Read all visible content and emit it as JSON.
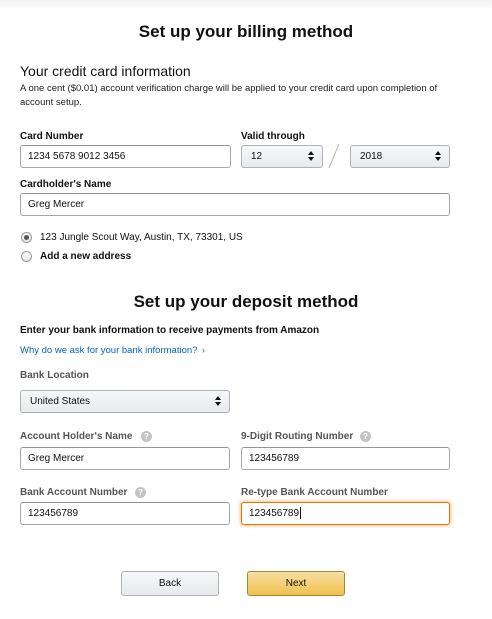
{
  "billing": {
    "title": "Set up your billing method",
    "card_heading": "Your credit card information",
    "description": "A one cent ($0.01) account verification charge will be applied to your credit card upon completion of account setup.",
    "card_number_label": "Card Number",
    "card_number_value": "1234 5678 9012 3456",
    "valid_through_label": "Valid through",
    "month_value": "12",
    "year_value": "2018",
    "cardholder_label": "Cardholder's Name",
    "cardholder_value": "Greg Mercer",
    "address_option": "123 Jungle Scout Way, Austin, TX, 73301, US",
    "new_address_option": "Add a new address"
  },
  "deposit": {
    "title": "Set up your deposit method",
    "intro": "Enter your bank information to receive payments from Amazon",
    "why_link": "Why do we ask for your bank information?",
    "bank_location_label": "Bank Location",
    "bank_location_value": "United States",
    "holder_label": "Account Holder's Name",
    "holder_value": "Greg Mercer",
    "routing_label": "9-Digit Routing Number",
    "routing_value": "123456789",
    "account_label": "Bank Account Number",
    "account_value": "123456789",
    "retype_label": "Re-type Bank Account Number",
    "retype_value": "123456789"
  },
  "actions": {
    "back_label": "Back",
    "next_label": "Next"
  },
  "icons": {
    "help": "?",
    "link_arrow": "›"
  },
  "colors": {
    "link": "#0066c0",
    "focus_border": "#e77600",
    "next_button": "#f0c14b"
  }
}
